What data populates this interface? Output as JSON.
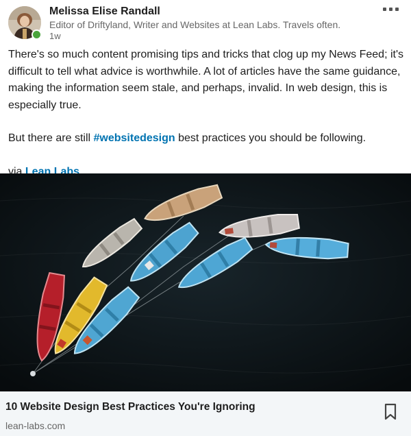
{
  "author": {
    "name": "Melissa Elise Randall",
    "headline": "Editor of Driftyland, Writer and Websites at Lean Labs. Travels often.",
    "time": "1w",
    "presence_color": "#4aa43c"
  },
  "menu": {
    "icon": "more-horizontal-icon"
  },
  "post": {
    "paragraph1": "There's so much content promising tips and tricks that clog up my News Feed; it's difficult to tell what advice is worthwhile. A lot of articles have the same guidance, making the information seem stale, and perhaps, invalid. In web design, this is especially true.",
    "p2_before": "But there are still ",
    "hashtag": "#websitedesign",
    "p2_after": " best practices you should be following.",
    "via_label": "via ",
    "via_link": "Lean Labs",
    "link_color": "#0073b1"
  },
  "image": {
    "subject": "colorful rowboats on dark water"
  },
  "link_card": {
    "title": "10 Website Design Best Practices You're Ignoring",
    "domain": "lean-labs.com",
    "save_icon": "bookmark-icon"
  }
}
